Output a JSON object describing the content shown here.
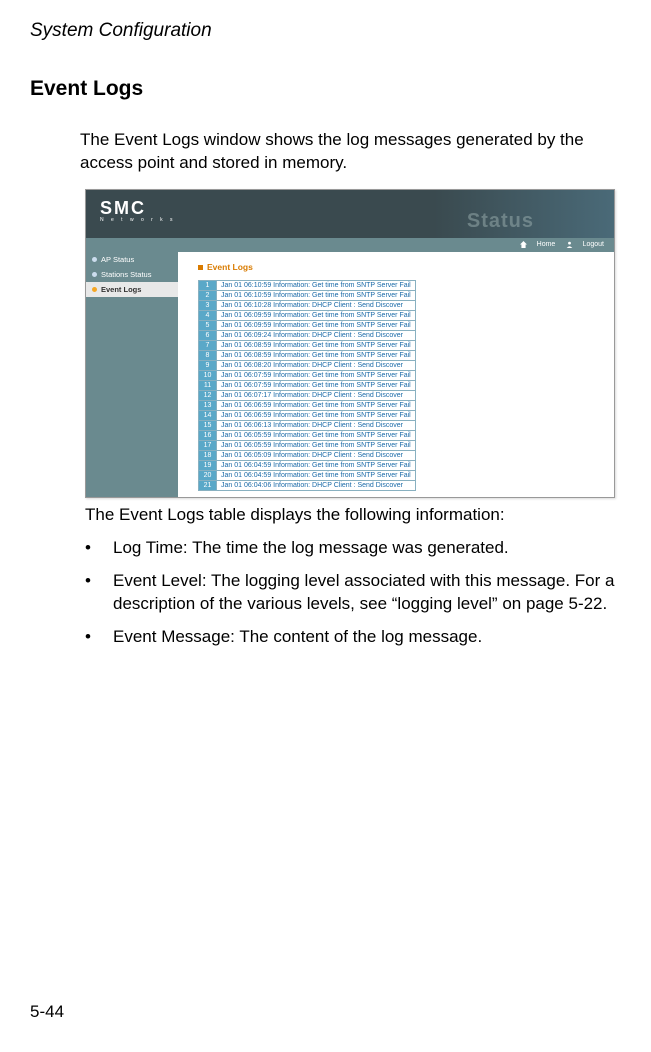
{
  "doc": {
    "header": "System Configuration",
    "section_title": "Event Logs",
    "intro": "The Event Logs window shows the log messages generated by the access point and stored in memory.",
    "follow": "The Event Logs table displays the following information:",
    "bullets": [
      "Log Time: The time the log message was generated.",
      "Event Level: The logging level associated with this message. For a description of the various levels, see “logging level” on page 5-22.",
      "Event Message: The content of the log message."
    ],
    "page_num": "5-44"
  },
  "screenshot": {
    "logo": "SMC",
    "logo_sub": "N e t w o r k s",
    "watermark": "Status",
    "toolbar": {
      "home": "Home",
      "logout": "Logout"
    },
    "sidebar": [
      {
        "label": "AP Status",
        "active": false
      },
      {
        "label": "Stations Status",
        "active": false
      },
      {
        "label": "Event Logs",
        "active": true
      }
    ],
    "main_title": "Event Logs",
    "logs": [
      {
        "n": "1",
        "msg": "Jan 01 06:10:59 Information: Get time from SNTP Server Fail"
      },
      {
        "n": "2",
        "msg": "Jan 01 06:10:59 Information: Get time from SNTP Server Fail"
      },
      {
        "n": "3",
        "msg": "Jan 01 06:10:28 Information: DHCP Client : Send Discover"
      },
      {
        "n": "4",
        "msg": "Jan 01 06:09:59 Information: Get time from SNTP Server Fail"
      },
      {
        "n": "5",
        "msg": "Jan 01 06:09:59 Information: Get time from SNTP Server Fail"
      },
      {
        "n": "6",
        "msg": "Jan 01 06:09:24 Information: DHCP Client : Send Discover"
      },
      {
        "n": "7",
        "msg": "Jan 01 06:08:59 Information: Get time from SNTP Server Fail"
      },
      {
        "n": "8",
        "msg": "Jan 01 06:08:59 Information: Get time from SNTP Server Fail"
      },
      {
        "n": "9",
        "msg": "Jan 01 06:08:20 Information: DHCP Client : Send Discover"
      },
      {
        "n": "10",
        "msg": "Jan 01 06:07:59 Information: Get time from SNTP Server Fail"
      },
      {
        "n": "11",
        "msg": "Jan 01 06:07:59 Information: Get time from SNTP Server Fail"
      },
      {
        "n": "12",
        "msg": "Jan 01 06:07:17 Information: DHCP Client : Send Discover"
      },
      {
        "n": "13",
        "msg": "Jan 01 06:06:59 Information: Get time from SNTP Server Fail"
      },
      {
        "n": "14",
        "msg": "Jan 01 06:06:59 Information: Get time from SNTP Server Fail"
      },
      {
        "n": "15",
        "msg": "Jan 01 06:06:13 Information: DHCP Client : Send Discover"
      },
      {
        "n": "16",
        "msg": "Jan 01 06:05:59 Information: Get time from SNTP Server Fail"
      },
      {
        "n": "17",
        "msg": "Jan 01 06:05:59 Information: Get time from SNTP Server Fail"
      },
      {
        "n": "18",
        "msg": "Jan 01 06:05:09 Information: DHCP Client : Send Discover"
      },
      {
        "n": "19",
        "msg": "Jan 01 06:04:59 Information: Get time from SNTP Server Fail"
      },
      {
        "n": "20",
        "msg": "Jan 01 06:04:59 Information: Get time from SNTP Server Fail"
      },
      {
        "n": "21",
        "msg": "Jan 01 06:04:06 Information: DHCP Client : Send Discover"
      }
    ]
  }
}
